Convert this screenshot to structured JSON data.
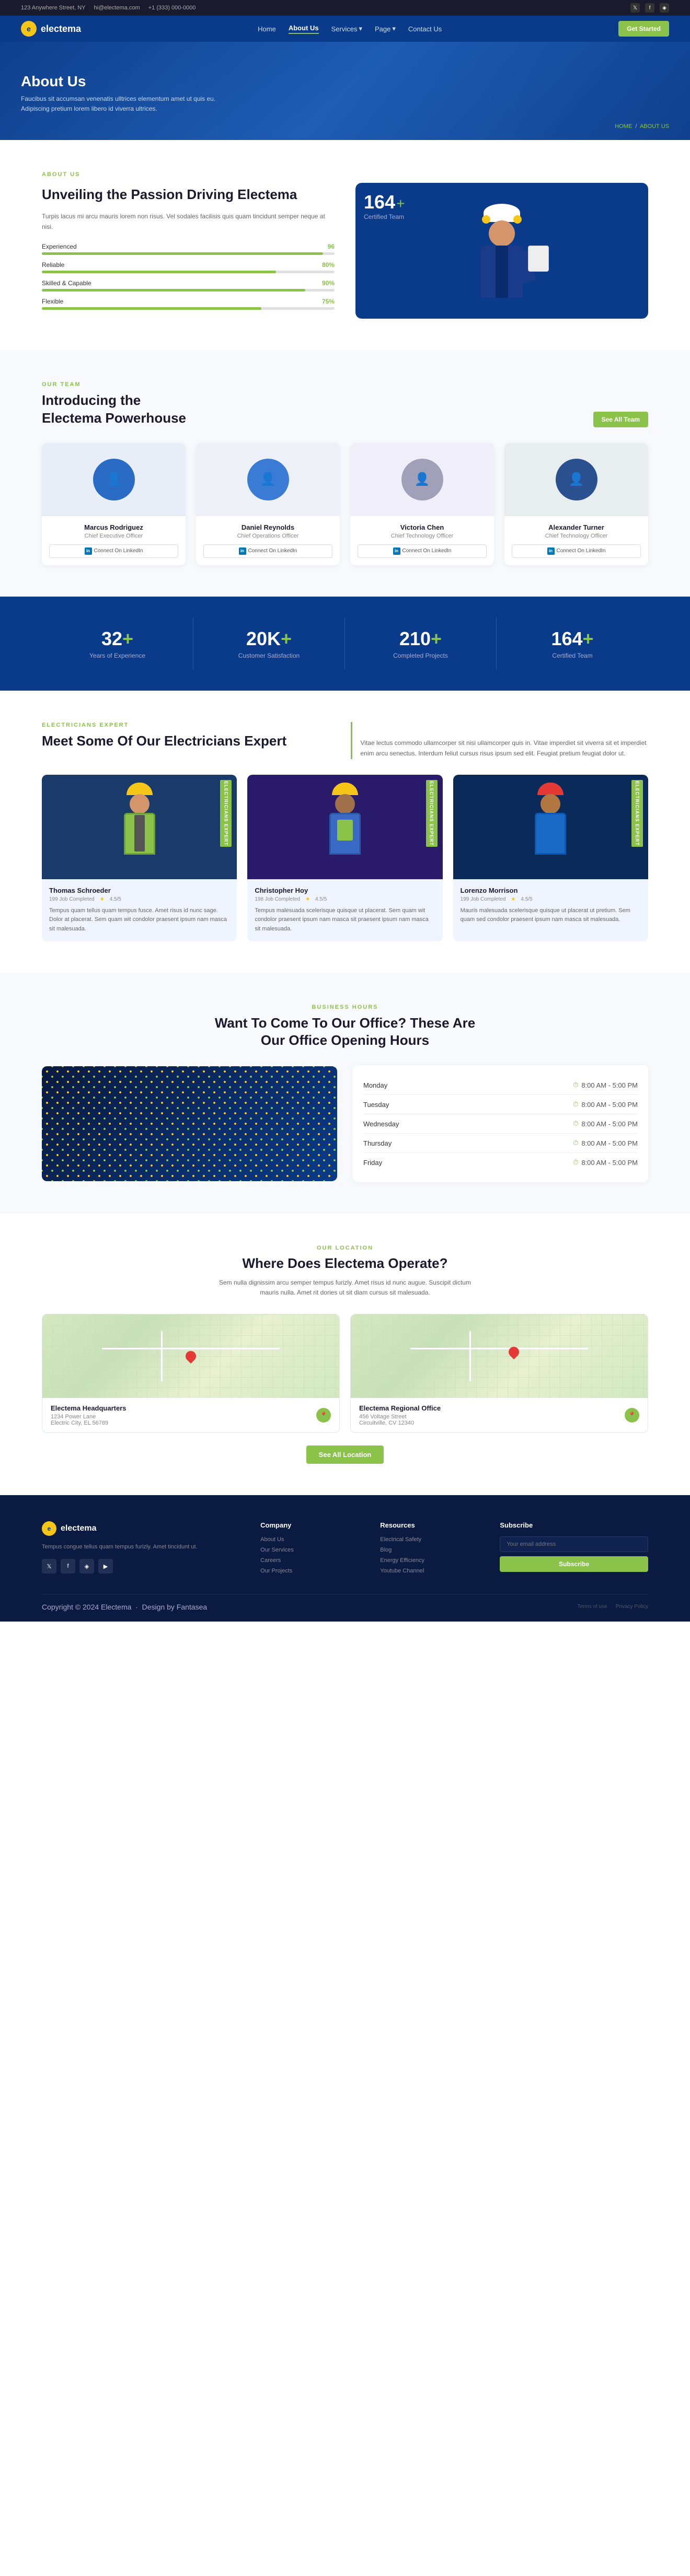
{
  "topbar": {
    "address": "123 Anywhere Street, NY",
    "email": "hi@electema.com",
    "phone": "+1 (333) 000-0000",
    "socials": [
      "twitter",
      "facebook",
      "instagram"
    ]
  },
  "nav": {
    "logo": "electema",
    "logo_initial": "e",
    "items": [
      {
        "label": "Home",
        "active": false
      },
      {
        "label": "About Us",
        "active": true
      },
      {
        "label": "Services",
        "active": false,
        "dropdown": true
      },
      {
        "label": "Page",
        "active": false,
        "dropdown": true
      },
      {
        "label": "Contact Us",
        "active": false
      }
    ],
    "cta": "Get Started"
  },
  "hero": {
    "title": "About Us",
    "description": "Faucibus sit accumsan venenatis ulltrices elementum amet ut quis eu. Adipiscing pretium lorem libero id viverra ultrices.",
    "breadcrumb_home": "HOME",
    "breadcrumb_current": "ABOUT US"
  },
  "about": {
    "label": "ABOUT US",
    "heading": "Unveiling the Passion Driving Electema",
    "description": "Turpis lacus mi arcu mauris lorem non risus. Vel sodales facilisis quis quam tincidunt semper neque at nisi.",
    "skills": [
      {
        "name": "Experienced",
        "percent": 96,
        "width": "96%"
      },
      {
        "name": "Reliable",
        "percent": 80,
        "width": "80%"
      },
      {
        "name": "Skilled & Capable",
        "percent": 90,
        "width": "90%"
      },
      {
        "name": "Flexible",
        "percent": 75,
        "width": "75%"
      }
    ],
    "cert_number": "164",
    "cert_label": "Certified Team"
  },
  "team": {
    "label": "OUR TEAM",
    "heading_line1": "Introducing the",
    "heading_line2": "Electema Powerhouse",
    "see_all": "See All Team",
    "members": [
      {
        "name": "Marcus Rodriguez",
        "role": "Chief Executive Officer",
        "color": "#2a6cc5"
      },
      {
        "name": "Daniel Reynolds",
        "role": "Chief Operations Officer",
        "color": "#3a7cd5"
      },
      {
        "name": "Victoria Chen",
        "role": "Chief Technology Officer",
        "color": "#b0b0c0"
      },
      {
        "name": "Alexander Turner",
        "role": "Chief Technology Officer",
        "color": "#2a5090"
      }
    ],
    "linkedin_label": "Connect On LinkedIn"
  },
  "stats": [
    {
      "number": "32",
      "label": "Years of Experience"
    },
    {
      "number": "20K",
      "label": "Customer Satisfaction"
    },
    {
      "number": "210",
      "label": "Completed Projects"
    },
    {
      "number": "164",
      "label": "Certified Team"
    }
  ],
  "electricians": {
    "label": "ELECTRICIANS EXPERT",
    "heading": "Meet Some Of Our Electricians Expert",
    "description": "Vitae lectus commodo ullamcorper sit nisi ullamcorper quis in. Vitae imperdiet sit viverra sit et imperdiet enim arcu senectus. Interdum feliut cursus risus ipsum sed elit. Feugiat pretium feugiat dolor ut.",
    "experts": [
      {
        "name": "Thomas Schroeder",
        "jobs": "199 Job Completed",
        "rating": "4.5/5",
        "badge": "ELECTRICIANS EXPERT",
        "desc": "Tempus quam tellus quam tempus fusce. Amet risus id nunc sage. Dolor at placerat. Sem quam wit condolor praesent ipsum nam masca sit malesuada.",
        "color": "#1a3a6a"
      },
      {
        "name": "Christopher Hoy",
        "jobs": "198 Job Completed",
        "rating": "4.5/5",
        "badge": "ELECTRICIANS EXPERT",
        "desc": "Tempus malesuada scelerisque quisque ut placerat. Sem quam wit condolor praesent ipsum nam masca sit praesent ipsum nam masca sit malesuada.",
        "color": "#2a1a6a"
      },
      {
        "name": "Lorenzo Morrison",
        "jobs": "199 Job Completed",
        "rating": "4.5/5",
        "badge": "ELECTRICIANS EXPERT",
        "desc": "Mauris malesuada scelerisque quisque ut placerat ut pretium. Sem quam sed condolor praesent ipsum nam masca sit malesuada.",
        "color": "#0a2a5a"
      }
    ]
  },
  "hours": {
    "label": "BUSINESS HOURS",
    "title": "Want To Come To Our Office? These Are Our Office Opening Hours",
    "schedule": [
      {
        "day": "Monday",
        "time": "8:00 AM - 5:00 PM"
      },
      {
        "day": "Tuesday",
        "time": "8:00 AM - 5:00 PM"
      },
      {
        "day": "Wednesday",
        "time": "8:00 AM - 5:00 PM"
      },
      {
        "day": "Thursday",
        "time": "8:00 AM - 5:00 PM"
      },
      {
        "day": "Friday",
        "time": "8:00 AM - 5:00 PM"
      }
    ]
  },
  "location": {
    "label": "OUR LOCATION",
    "title": "Where Does Electema Operate?",
    "description": "Sem nulla dignissim arcu semper tempus furizly. Amet risus id nunc augue. Suscipit dictum mauris nulla. Amet rit dories ut sit diam cursus sit malesuada.",
    "offices": [
      {
        "name": "Electema Headquarters",
        "address_line1": "1234 Power Lane",
        "address_line2": "Electric City, EL 56789"
      },
      {
        "name": "Electema Regional Office",
        "address_line1": "456 Voltage Street",
        "address_line2": "Circuitville, CV 12340"
      }
    ],
    "see_all": "See All Location"
  },
  "footer": {
    "logo": "electema",
    "logo_initial": "e",
    "description": "Tempus congue tellus quam tempus furizly. Amet tincidunt ut.",
    "company_col": {
      "title": "Company",
      "links": [
        "About Us",
        "Our Services",
        "Careers",
        "Our Projects"
      ]
    },
    "resources_col": {
      "title": "Resources",
      "links": [
        "Electrical Safety",
        "Blog",
        "Energy Efficiency",
        "Youtube Channel"
      ]
    },
    "subscribe_col": {
      "title": "Subscribe",
      "placeholder": "",
      "button": "Subscribe"
    },
    "copyright": "Copyright © 2024 Electema",
    "design_credit": "Design by Fantasea",
    "bottom_links": [
      "Terms of use",
      "Privacy Policy"
    ]
  }
}
